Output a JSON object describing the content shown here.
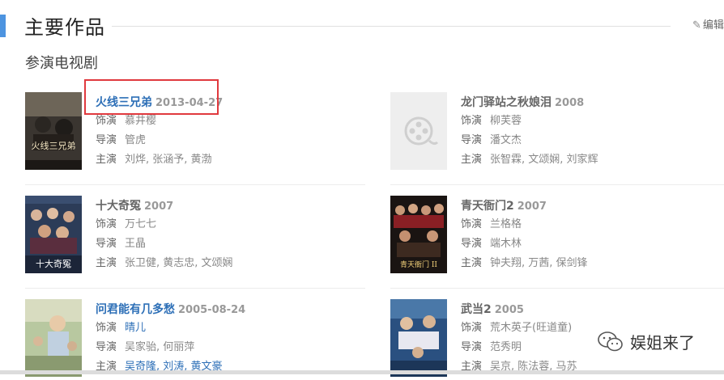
{
  "header": {
    "title": "主要作品",
    "edit_label": "编辑"
  },
  "subsection": {
    "title": "参演电视剧"
  },
  "labels": {
    "role": "饰演",
    "director": "导演",
    "cast": "主演"
  },
  "works": [
    {
      "title": "火线三兄弟",
      "date": "2013-04-27",
      "role": "慕井樱",
      "director": "管虎",
      "cast": "刘烨, 张涵予, 黄渤"
    },
    {
      "title": "龙门驿站之秋娘泪",
      "date": "2008",
      "role": "柳芙蓉",
      "director": "潘文杰",
      "cast": "张智霖, 文颂娴, 刘家辉"
    },
    {
      "title": "十大奇冤",
      "date": "2007",
      "role": "万七七",
      "director": "王晶",
      "cast": "张卫健, 黄志忠, 文颂娴"
    },
    {
      "title": "青天衙门2",
      "date": "2007",
      "role": "兰格格",
      "director": "端木林",
      "cast": "钟夫翔, 万茜, 保剑锋"
    },
    {
      "title": "问君能有几多愁",
      "date": "2005-08-24",
      "role": "晴儿",
      "director": "吴家骀, 何丽萍",
      "cast": "吴奇隆, 刘涛, 黄文豪"
    },
    {
      "title": "武当2",
      "date": "2005",
      "role": "荒木英子(旺道童)",
      "director": "范秀明",
      "cast": "吴京, 陈法蓉, 马苏"
    }
  ],
  "poster_text": {
    "w0": "火线三兄弟",
    "w2": "十大奇冤",
    "w3": "青天衙门 II"
  },
  "watermark": {
    "text": "娱姐来了"
  },
  "colors": {
    "link": "#2d6fb7",
    "accent": "#4d94e0",
    "highlight": "#e0393e"
  }
}
